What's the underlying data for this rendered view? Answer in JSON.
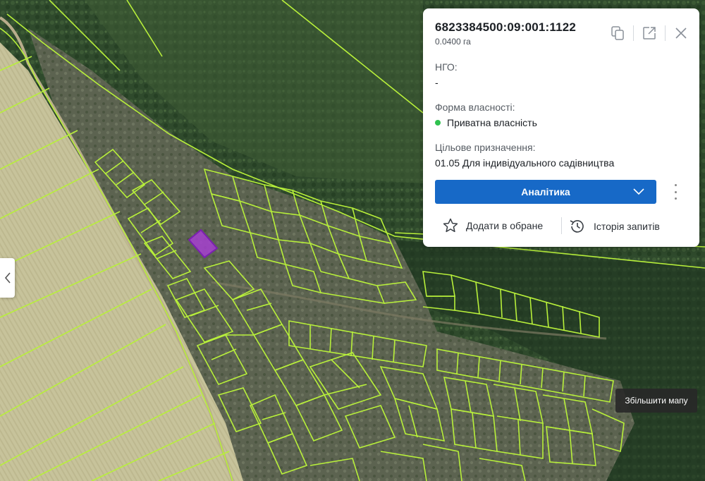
{
  "parcel": {
    "cadastral_number": "6823384500:09:001:1122",
    "area": "0.0400 га",
    "ngo_label": "НГО:",
    "ngo_value": "-",
    "ownership_label": "Форма власності:",
    "ownership_value": "Приватна власність",
    "purpose_label": "Цільове призначення:",
    "purpose_value": "01.05 Для індивідуального садівництва"
  },
  "actions": {
    "analytics_label": "Аналітика",
    "favorite_label": "Додати в обране",
    "history_label": "Історія запитів"
  },
  "tooltip": {
    "zoom_map": "Збільшити мапу"
  },
  "colors": {
    "parcel_outline": "#b8f03a",
    "selected_parcel": "#a63fd0",
    "accent_button": "#1769c7",
    "status_dot": "#2fc14f"
  },
  "icons": {
    "copy": "copy-icon",
    "open": "external-link-icon",
    "close": "close-icon",
    "favorite": "star-icon",
    "history": "history-icon",
    "collapse": "chevron-left-icon"
  }
}
